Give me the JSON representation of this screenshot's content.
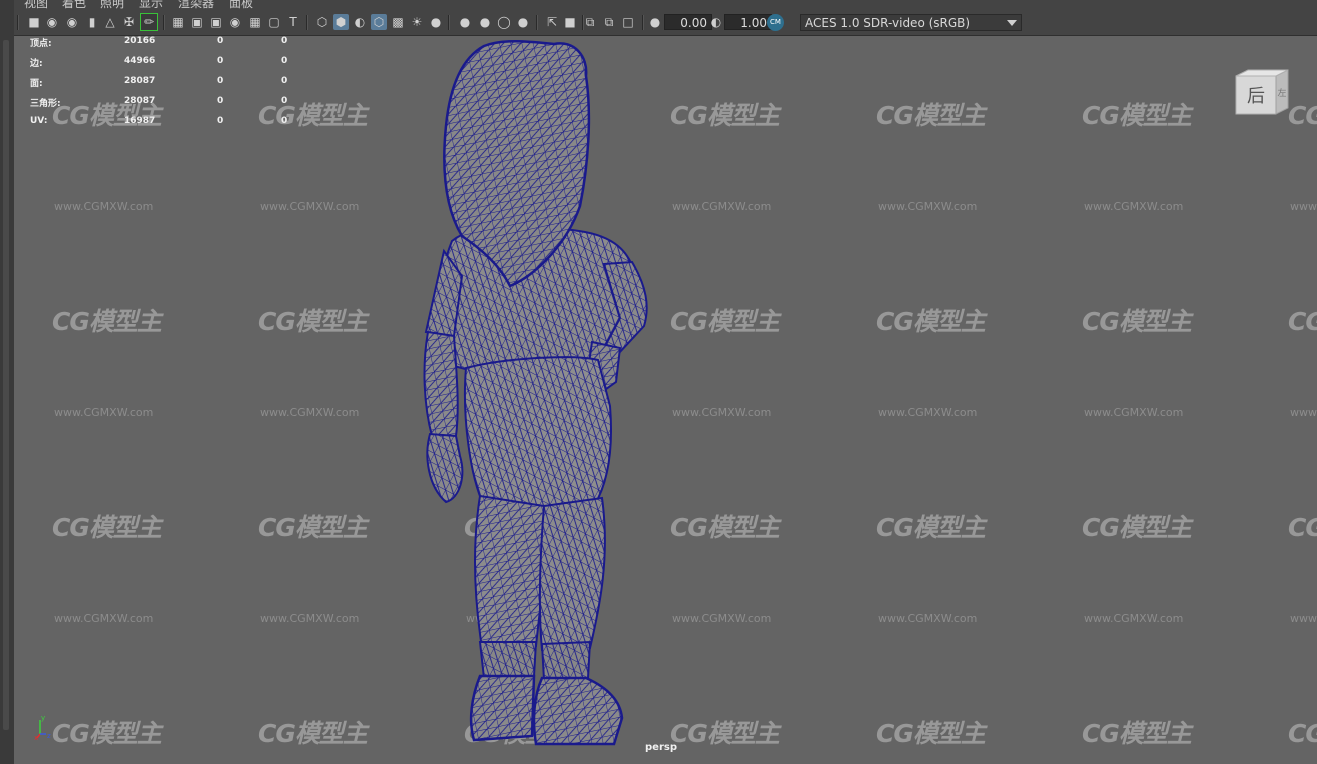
{
  "menu": {
    "items": [
      "视图",
      "着色",
      "照明",
      "显示",
      "渲染器",
      "面板"
    ]
  },
  "toolbar": {
    "exposure_value": "0.00",
    "gamma_value": "1.00",
    "color_management_badge": "CM",
    "color_space": "ACES 1.0 SDR-video (sRGB)",
    "icons": [
      "select-camera-icon",
      "camera-attributes-icon",
      "bookmark-icon",
      "image-plane-icon",
      "2d-pan-zoom-icon",
      "grease-pencil-icon",
      "grid-icon",
      "film-gate-icon",
      "resolution-gate-icon",
      "gate-mask-icon",
      "field-chart-icon",
      "safe-action-icon",
      "safe-title-icon",
      "wireframe-icon",
      "smooth-shade-icon",
      "flat-shade-icon",
      "wireframe-on-shaded-icon",
      "xray-icon",
      "use-lights-icon",
      "shadows-icon",
      "ambient-occlusion-icon",
      "motion-blur-icon",
      "anti-aliasing-icon",
      "depth-of-field-icon",
      "isolate-select-icon",
      "xray-joints-icon",
      "textured-icon",
      "exposure-icon",
      "gamma-icon"
    ]
  },
  "hud": {
    "rows": [
      {
        "label": "顶点:",
        "total": "20166",
        "selected": "0",
        "components": "0"
      },
      {
        "label": "边:",
        "total": "44966",
        "selected": "0",
        "components": "0"
      },
      {
        "label": "面:",
        "total": "28087",
        "selected": "0",
        "components": "0"
      },
      {
        "label": "三角形:",
        "total": "28087",
        "selected": "0",
        "components": "0"
      },
      {
        "label": "UV:",
        "total": "16987",
        "selected": "0",
        "components": "0"
      }
    ]
  },
  "viewcube": {
    "face_label": "后",
    "side_label": "左"
  },
  "axis": {
    "x": "x",
    "y": "y",
    "z": "z"
  },
  "camera": {
    "label": "persp"
  },
  "watermark": {
    "logo": "CG模型主",
    "url": "www.CGMXW.com"
  },
  "colors": {
    "viewport_bg": "#646464",
    "panel_bg": "#444444",
    "wire": "#1a1a8c",
    "mesh_fill": "#8a8a8a",
    "hud_text": "#f0f0f0",
    "active_icon": "#5a7c99"
  }
}
